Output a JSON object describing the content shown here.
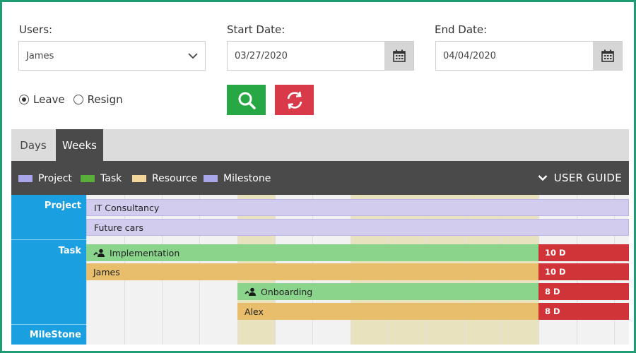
{
  "filters": {
    "users_label": "Users:",
    "user_value": "James",
    "start_label": "Start Date:",
    "start_value": "03/27/2020",
    "end_label": "End Date:",
    "end_value": "04/04/2020"
  },
  "type_options": [
    {
      "label": "Leave",
      "selected": true
    },
    {
      "label": "Resign",
      "selected": false
    }
  ],
  "tabs": [
    {
      "label": "Days",
      "active": false
    },
    {
      "label": "Weeks",
      "active": true
    }
  ],
  "legend": [
    {
      "label": "Project",
      "color": "#a9a6ea"
    },
    {
      "label": "Task",
      "color": "#5aae3a"
    },
    {
      "label": "Resource",
      "color": "#f3d79a"
    },
    {
      "label": "Milestone",
      "color": "#a9a6ea"
    }
  ],
  "user_guide_label": "USER GUIDE",
  "rows": {
    "project": "Project",
    "task": "Task",
    "milestone": "MileStone"
  },
  "bars": {
    "project_1": "IT Consultancy",
    "project_2": "Future cars",
    "task_1": "Implementation",
    "task_1_duration": "10 D",
    "resource_1": "James",
    "resource_1_duration": "10 D",
    "task_2": "Onboarding",
    "task_2_duration": "8 D",
    "resource_2": "Alex",
    "resource_2_duration": "8 D"
  },
  "colors": {
    "frame": "#1f9c74",
    "search_button": "#28a845",
    "reset_button": "#d83a4a",
    "sidebar": "#1a9fe0",
    "duration": "#d13438"
  }
}
